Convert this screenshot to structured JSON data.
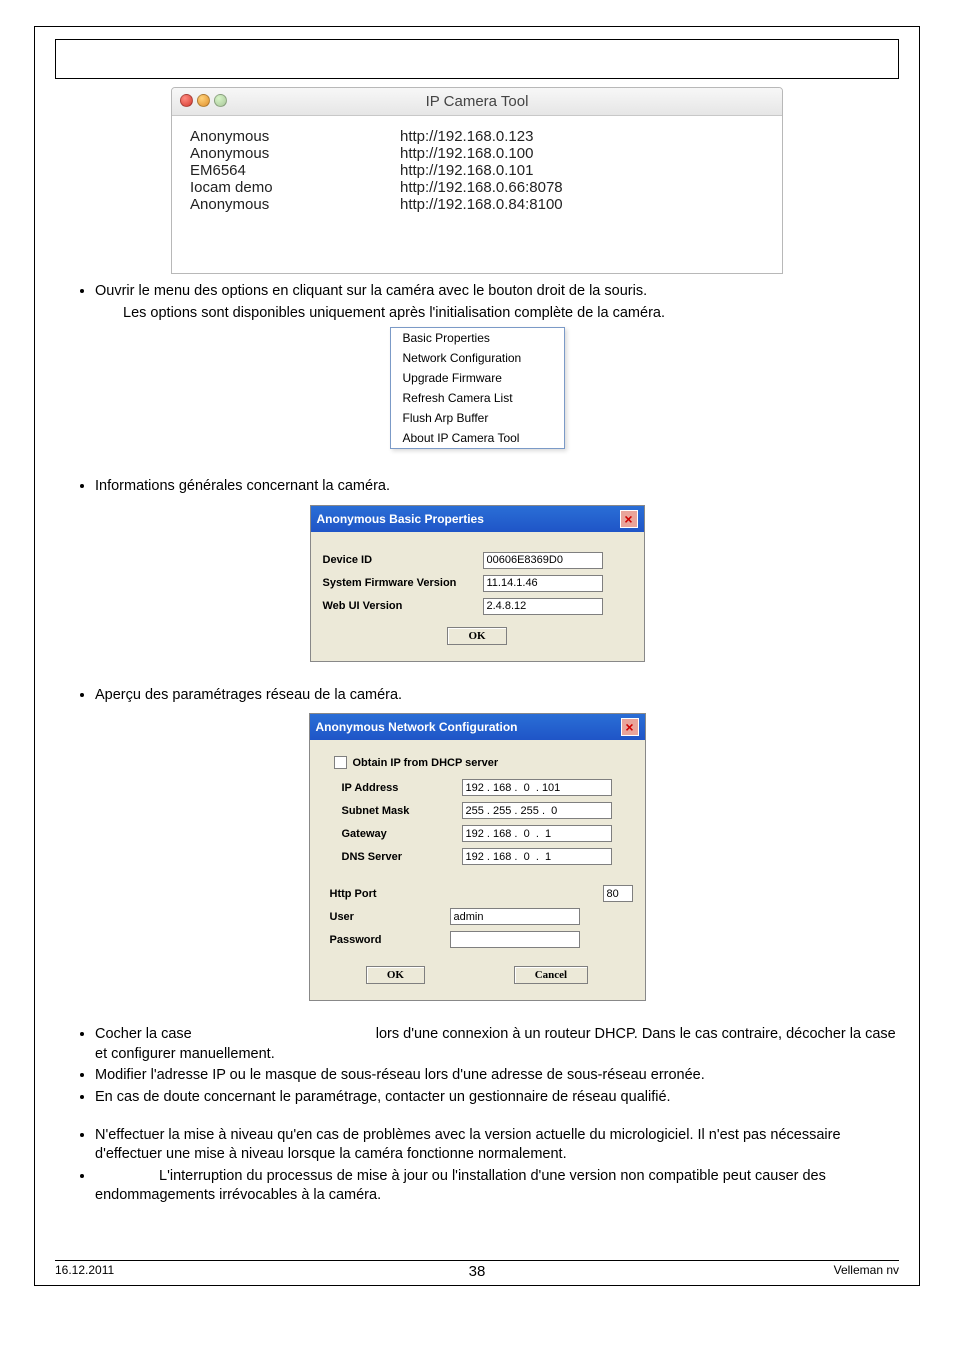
{
  "ipcam": {
    "title": "IP Camera Tool",
    "rows": [
      {
        "name": "Anonymous",
        "url": "http://192.168.0.123"
      },
      {
        "name": "Anonymous",
        "url": "http://192.168.0.100"
      },
      {
        "name": "EM6564",
        "url": "http://192.168.0.101"
      },
      {
        "name": "Iocam demo",
        "url": "http://192.168.0.66:8078"
      },
      {
        "name": "Anonymous",
        "url": "http://192.168.0.84:8100"
      }
    ]
  },
  "bullets": {
    "b1": "Ouvrir le menu des options en cliquant sur la caméra avec le bouton droit de la souris.",
    "b1_note": "Les options sont disponibles uniquement après l'initialisation complète de la caméra.",
    "b2": "Informations générales concernant la caméra.",
    "b3": "Aperçu des paramétrages réseau de la caméra.",
    "b4a": "Cocher la case",
    "b4b": "lors d'une connexion à un routeur DHCP. Dans le cas contraire, décocher la case et configurer manuellement.",
    "b5": "Modifier l'adresse IP ou le masque de sous-réseau lors d'une adresse de sous-réseau erronée.",
    "b6": "En cas de doute concernant le paramétrage, contacter un gestionnaire de réseau qualifié.",
    "b7": "N'effectuer la mise à niveau qu'en cas de problèmes avec la version actuelle du micrologiciel. Il n'est pas nécessaire d'effectuer une mise à niveau lorsque la caméra fonctionne normalement.",
    "b8": "L'interruption du processus de mise à jour ou l'installation d'une version non compatible peut causer des endommagements irrévocables à la caméra."
  },
  "context_menu": [
    "Basic Properties",
    "Network Configuration",
    "Upgrade Firmware",
    "Refresh Camera List",
    "Flush Arp Buffer",
    "About IP Camera Tool"
  ],
  "basic_props": {
    "title": "Anonymous Basic Properties",
    "labels": {
      "device_id": "Device ID",
      "fw": "System Firmware Version",
      "webui": "Web UI Version"
    },
    "values": {
      "device_id": "00606E8369D0",
      "fw": "11.14.1.46",
      "webui": "2.4.8.12"
    },
    "ok": "OK"
  },
  "net_conf": {
    "title": "Anonymous Network Configuration",
    "dhcp_label": "Obtain IP from DHCP server",
    "labels": {
      "ip": "IP Address",
      "subnet": "Subnet Mask",
      "gateway": "Gateway",
      "dns": "DNS Server",
      "port": "Http Port",
      "user": "User",
      "password": "Password"
    },
    "values": {
      "ip": "192 . 168 .  0  . 101",
      "subnet": "255 . 255 . 255 .  0",
      "gateway": "192 . 168 .  0  .  1",
      "dns": "192 . 168 .  0  .  1",
      "port": "80",
      "user": "admin",
      "password": ""
    },
    "ok": "OK",
    "cancel": "Cancel"
  },
  "footer": {
    "date": "16.12.2011",
    "page": "38",
    "company": "Velleman nv"
  }
}
